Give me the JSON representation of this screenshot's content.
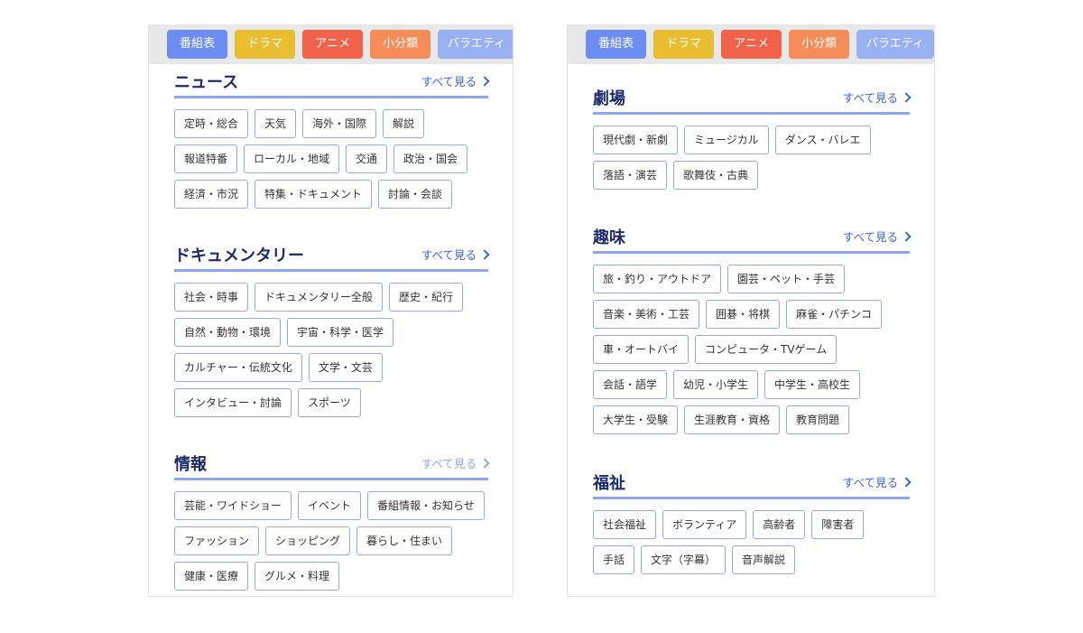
{
  "colors": {
    "blue": "#6c8ef0",
    "yellow": "#e8bd2f",
    "red": "#f0624a",
    "orange": "#f68d58",
    "lightblue": "#97b1f2",
    "accent": "#3a64d8"
  },
  "left": {
    "tabs": [
      "番組表",
      "ドラマ",
      "アニメ",
      "小分類",
      "バラエティ"
    ],
    "sections": [
      {
        "title": "ニュース",
        "see_all": "すべて見る",
        "chips": [
          "定時・総合",
          "天気",
          "海外・国際",
          "解説",
          "報道特番",
          "ローカル・地域",
          "交通",
          "政治・国会",
          "経済・市況",
          "特集・ドキュメント",
          "討論・会談"
        ]
      },
      {
        "title": "ドキュメンタリー",
        "see_all": "すべて見る",
        "chips": [
          "社会・時事",
          "ドキュメンタリー全般",
          "歴史・紀行",
          "自然・動物・環境",
          "宇宙・科学・医学",
          "カルチャー・伝統文化",
          "文学・文芸",
          "インタビュー・討論",
          "スポーツ"
        ]
      },
      {
        "title": "情報",
        "see_all": "すべて見る",
        "chips": [
          "芸能・ワイドショー",
          "イベント",
          "番組情報・お知らせ",
          "ファッション",
          "ショッピング",
          "暮らし・住まい",
          "健康・医療",
          "グルメ・料理"
        ]
      }
    ]
  },
  "right": {
    "tabs": [
      "番組表",
      "ドラマ",
      "アニメ",
      "小分類",
      "バラエティ"
    ],
    "sections": [
      {
        "title": "劇場",
        "see_all": "すべて見る",
        "chips": [
          "現代劇・新劇",
          "ミュージカル",
          "ダンス・バレエ",
          "落語・演芸",
          "歌舞伎・古典"
        ]
      },
      {
        "title": "趣味",
        "see_all": "すべて見る",
        "chips": [
          "旅・釣り・アウトドア",
          "園芸・ペット・手芸",
          "音楽・美術・工芸",
          "囲碁・将棋",
          "麻雀・パチンコ",
          "車・オートバイ",
          "コンピュータ・TVゲーム",
          "会話・語学",
          "幼児・小学生",
          "中学生・高校生",
          "大学生・受験",
          "生涯教育・資格",
          "教育問題"
        ]
      },
      {
        "title": "福祉",
        "see_all": "すべて見る",
        "chips": [
          "社会福祉",
          "ボランティア",
          "高齢者",
          "障害者",
          "手話",
          "文字（字幕）",
          "音声解説"
        ]
      }
    ]
  }
}
